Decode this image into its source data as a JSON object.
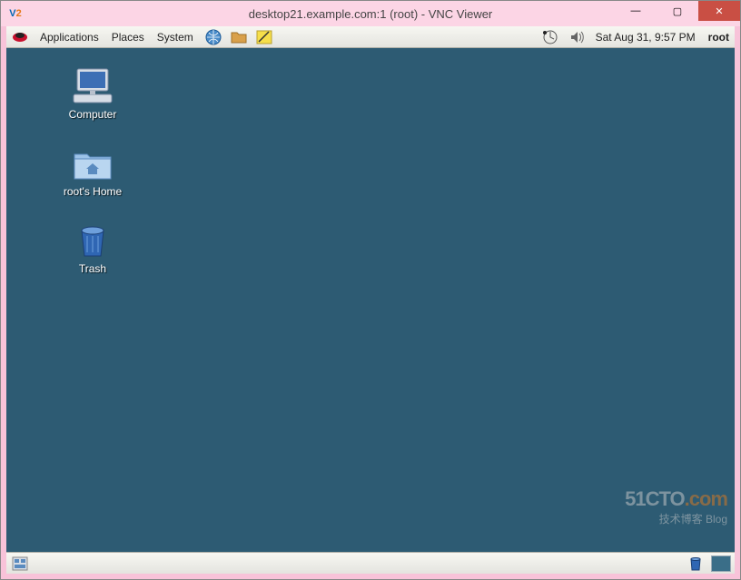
{
  "window": {
    "title": "desktop21.example.com:1 (root) - VNC Viewer",
    "logo": {
      "v": "V",
      "two": "2"
    },
    "buttons": {
      "min": "—",
      "max": "▢",
      "close": "✕"
    }
  },
  "panel": {
    "menus": [
      "Applications",
      "Places",
      "System"
    ],
    "clock": "Sat Aug 31,  9:57 PM",
    "user": "root"
  },
  "desktop": {
    "icons": [
      {
        "label": "Computer"
      },
      {
        "label": "root's Home"
      },
      {
        "label": "Trash"
      }
    ]
  },
  "watermark": {
    "main": "51CTO",
    "dotcom": ".com",
    "sub": "技术博客   Blog"
  }
}
